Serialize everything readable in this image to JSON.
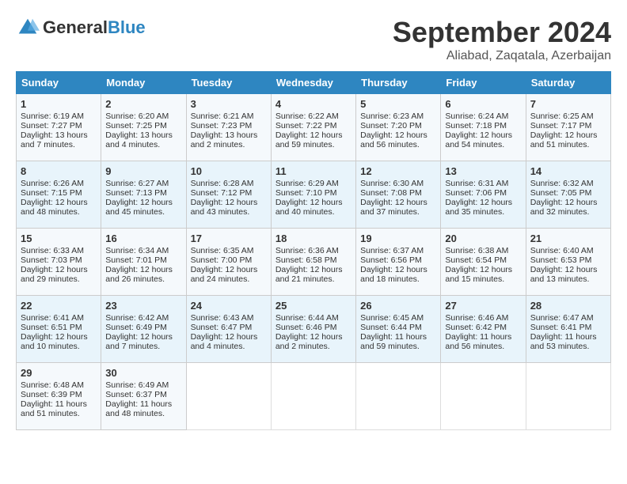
{
  "header": {
    "logo_general": "General",
    "logo_blue": "Blue",
    "month": "September 2024",
    "location": "Aliabad, Zaqatala, Azerbaijan"
  },
  "columns": [
    "Sunday",
    "Monday",
    "Tuesday",
    "Wednesday",
    "Thursday",
    "Friday",
    "Saturday"
  ],
  "weeks": [
    [
      {
        "day": "1",
        "sunrise": "6:19 AM",
        "sunset": "7:27 PM",
        "daylight": "13 hours and 7 minutes."
      },
      {
        "day": "2",
        "sunrise": "6:20 AM",
        "sunset": "7:25 PM",
        "daylight": "13 hours and 4 minutes."
      },
      {
        "day": "3",
        "sunrise": "6:21 AM",
        "sunset": "7:23 PM",
        "daylight": "13 hours and 2 minutes."
      },
      {
        "day": "4",
        "sunrise": "6:22 AM",
        "sunset": "7:22 PM",
        "daylight": "12 hours and 59 minutes."
      },
      {
        "day": "5",
        "sunrise": "6:23 AM",
        "sunset": "7:20 PM",
        "daylight": "12 hours and 56 minutes."
      },
      {
        "day": "6",
        "sunrise": "6:24 AM",
        "sunset": "7:18 PM",
        "daylight": "12 hours and 54 minutes."
      },
      {
        "day": "7",
        "sunrise": "6:25 AM",
        "sunset": "7:17 PM",
        "daylight": "12 hours and 51 minutes."
      }
    ],
    [
      {
        "day": "8",
        "sunrise": "6:26 AM",
        "sunset": "7:15 PM",
        "daylight": "12 hours and 48 minutes."
      },
      {
        "day": "9",
        "sunrise": "6:27 AM",
        "sunset": "7:13 PM",
        "daylight": "12 hours and 45 minutes."
      },
      {
        "day": "10",
        "sunrise": "6:28 AM",
        "sunset": "7:12 PM",
        "daylight": "12 hours and 43 minutes."
      },
      {
        "day": "11",
        "sunrise": "6:29 AM",
        "sunset": "7:10 PM",
        "daylight": "12 hours and 40 minutes."
      },
      {
        "day": "12",
        "sunrise": "6:30 AM",
        "sunset": "7:08 PM",
        "daylight": "12 hours and 37 minutes."
      },
      {
        "day": "13",
        "sunrise": "6:31 AM",
        "sunset": "7:06 PM",
        "daylight": "12 hours and 35 minutes."
      },
      {
        "day": "14",
        "sunrise": "6:32 AM",
        "sunset": "7:05 PM",
        "daylight": "12 hours and 32 minutes."
      }
    ],
    [
      {
        "day": "15",
        "sunrise": "6:33 AM",
        "sunset": "7:03 PM",
        "daylight": "12 hours and 29 minutes."
      },
      {
        "day": "16",
        "sunrise": "6:34 AM",
        "sunset": "7:01 PM",
        "daylight": "12 hours and 26 minutes."
      },
      {
        "day": "17",
        "sunrise": "6:35 AM",
        "sunset": "7:00 PM",
        "daylight": "12 hours and 24 minutes."
      },
      {
        "day": "18",
        "sunrise": "6:36 AM",
        "sunset": "6:58 PM",
        "daylight": "12 hours and 21 minutes."
      },
      {
        "day": "19",
        "sunrise": "6:37 AM",
        "sunset": "6:56 PM",
        "daylight": "12 hours and 18 minutes."
      },
      {
        "day": "20",
        "sunrise": "6:38 AM",
        "sunset": "6:54 PM",
        "daylight": "12 hours and 15 minutes."
      },
      {
        "day": "21",
        "sunrise": "6:40 AM",
        "sunset": "6:53 PM",
        "daylight": "12 hours and 13 minutes."
      }
    ],
    [
      {
        "day": "22",
        "sunrise": "6:41 AM",
        "sunset": "6:51 PM",
        "daylight": "12 hours and 10 minutes."
      },
      {
        "day": "23",
        "sunrise": "6:42 AM",
        "sunset": "6:49 PM",
        "daylight": "12 hours and 7 minutes."
      },
      {
        "day": "24",
        "sunrise": "6:43 AM",
        "sunset": "6:47 PM",
        "daylight": "12 hours and 4 minutes."
      },
      {
        "day": "25",
        "sunrise": "6:44 AM",
        "sunset": "6:46 PM",
        "daylight": "12 hours and 2 minutes."
      },
      {
        "day": "26",
        "sunrise": "6:45 AM",
        "sunset": "6:44 PM",
        "daylight": "11 hours and 59 minutes."
      },
      {
        "day": "27",
        "sunrise": "6:46 AM",
        "sunset": "6:42 PM",
        "daylight": "11 hours and 56 minutes."
      },
      {
        "day": "28",
        "sunrise": "6:47 AM",
        "sunset": "6:41 PM",
        "daylight": "11 hours and 53 minutes."
      }
    ],
    [
      {
        "day": "29",
        "sunrise": "6:48 AM",
        "sunset": "6:39 PM",
        "daylight": "11 hours and 51 minutes."
      },
      {
        "day": "30",
        "sunrise": "6:49 AM",
        "sunset": "6:37 PM",
        "daylight": "11 hours and 48 minutes."
      },
      null,
      null,
      null,
      null,
      null
    ]
  ]
}
